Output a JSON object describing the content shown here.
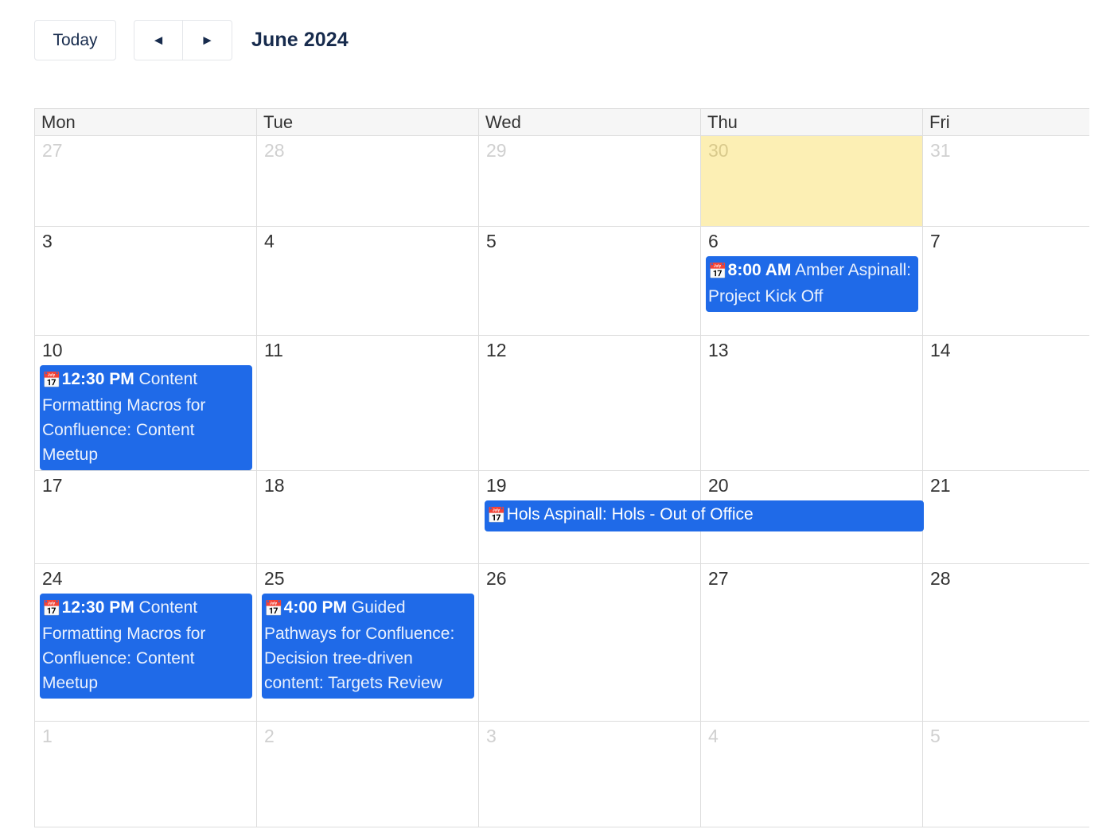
{
  "toolbar": {
    "today_label": "Today",
    "prev_label": "◄",
    "next_label": "►",
    "prev_icon": "prev-arrow-icon",
    "next_icon": "next-arrow-icon",
    "title": "June 2024"
  },
  "calendar": {
    "accent_color": "#1f6ae8",
    "today_bg_color": "#fcefb4",
    "grid_line_color": "#dddddd",
    "header_bg_color": "#f6f6f6",
    "event_icon": "calendar-icon",
    "event_icon_glyph": "📅",
    "day_headers": [
      "Mon",
      "Tue",
      "Wed",
      "Thu",
      "Fri"
    ],
    "weeks": [
      {
        "days": [
          {
            "num": "27",
            "other_month": true,
            "today": false
          },
          {
            "num": "28",
            "other_month": true,
            "today": false
          },
          {
            "num": "29",
            "other_month": true,
            "today": false
          },
          {
            "num": "30",
            "other_month": true,
            "today": true
          },
          {
            "num": "31",
            "other_month": true,
            "today": false
          }
        ]
      },
      {
        "days": [
          {
            "num": "3",
            "other_month": false,
            "today": false
          },
          {
            "num": "4",
            "other_month": false,
            "today": false
          },
          {
            "num": "5",
            "other_month": false,
            "today": false
          },
          {
            "num": "6",
            "other_month": false,
            "today": false,
            "events": [
              {
                "time": "8:00 AM",
                "title": " Amber Aspinall: Project Kick Off"
              }
            ]
          },
          {
            "num": "7",
            "other_month": false,
            "today": false
          }
        ]
      },
      {
        "days": [
          {
            "num": "10",
            "other_month": false,
            "today": false,
            "events": [
              {
                "time": "12:30 PM",
                "title": " Content Formatting Macros for Confluence: Content Meetup"
              }
            ]
          },
          {
            "num": "11",
            "other_month": false,
            "today": false
          },
          {
            "num": "12",
            "other_month": false,
            "today": false
          },
          {
            "num": "13",
            "other_month": false,
            "today": false
          },
          {
            "num": "14",
            "other_month": false,
            "today": false
          }
        ]
      },
      {
        "days": [
          {
            "num": "17",
            "other_month": false,
            "today": false
          },
          {
            "num": "18",
            "other_month": false,
            "today": false
          },
          {
            "num": "19",
            "other_month": false,
            "today": false
          },
          {
            "num": "20",
            "other_month": false,
            "today": false
          },
          {
            "num": "21",
            "other_month": false,
            "today": false
          }
        ],
        "span_event": {
          "time": "",
          "title": "Hols Aspinall: Hols - Out of Office"
        }
      },
      {
        "days": [
          {
            "num": "24",
            "other_month": false,
            "today": false,
            "events": [
              {
                "time": "12:30 PM",
                "title": " Content Formatting Macros for Confluence: Content Meetup"
              }
            ]
          },
          {
            "num": "25",
            "other_month": false,
            "today": false,
            "events": [
              {
                "time": "4:00 PM",
                "title": " Guided Pathways for Confluence: Decision tree-driven content: Targets Review"
              }
            ]
          },
          {
            "num": "26",
            "other_month": false,
            "today": false
          },
          {
            "num": "27",
            "other_month": false,
            "today": false
          },
          {
            "num": "28",
            "other_month": false,
            "today": false
          }
        ]
      },
      {
        "days": [
          {
            "num": "1",
            "other_month": true,
            "today": false
          },
          {
            "num": "2",
            "other_month": true,
            "today": false
          },
          {
            "num": "3",
            "other_month": true,
            "today": false
          },
          {
            "num": "4",
            "other_month": true,
            "today": false
          },
          {
            "num": "5",
            "other_month": true,
            "today": false
          }
        ]
      }
    ]
  }
}
